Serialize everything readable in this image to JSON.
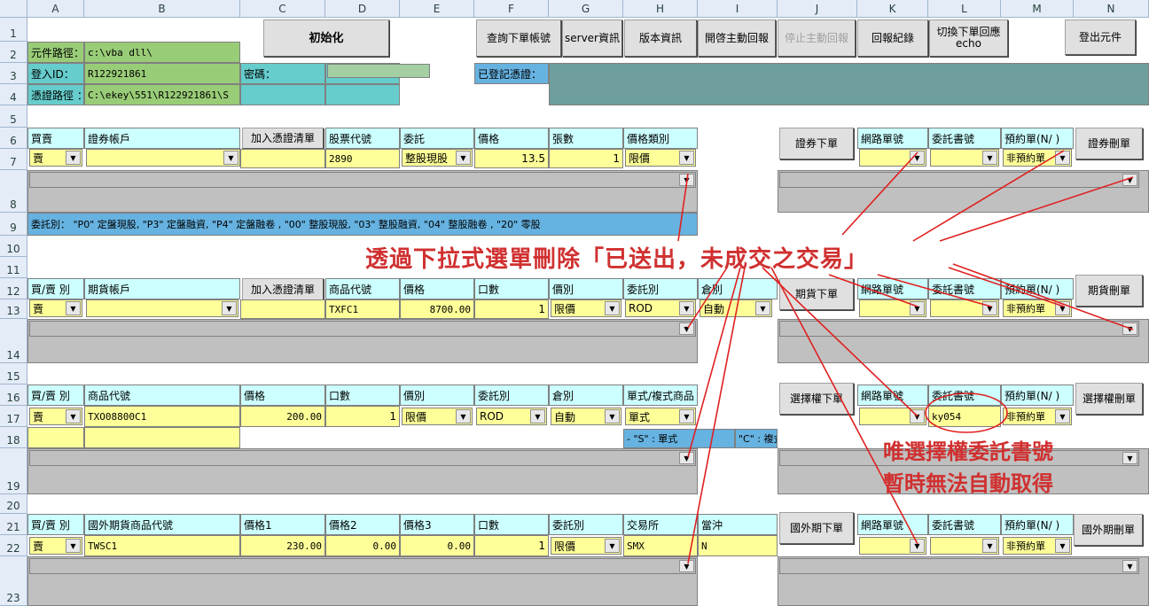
{
  "columns": [
    "A",
    "B",
    "C",
    "D",
    "E",
    "F",
    "G",
    "H",
    "I",
    "J",
    "K",
    "L",
    "M",
    "N"
  ],
  "rows": [
    "1",
    "2",
    "3",
    "4",
    "5",
    "6",
    "7",
    "8",
    "9",
    "10",
    "11",
    "12",
    "13",
    "14",
    "15",
    "16",
    "17",
    "18",
    "19",
    "20",
    "21",
    "22",
    "23"
  ],
  "top": {
    "init_button": "初始化",
    "query_account_button": "查詢下單帳號",
    "server_info_button": "server資訊",
    "version_button": "版本資訊",
    "open_reply_button": "開啓主動回報",
    "stop_reply_button": "停止主動回報",
    "reply_log_button": "回報紀錄",
    "switch_echo_button_line1": "切換下單回應",
    "switch_echo_button_line2": "echo",
    "logout_button": "登出元件",
    "dll_path_label": "元件路徑：",
    "dll_path_value": "c:\\vba dll\\",
    "login_id_label": "登入ID：",
    "login_id_value": "R122921861",
    "password_label": "密碼：",
    "cert_path_label": "憑證路徑 ：",
    "cert_path_value": "C:\\ekey\\551\\R122921861\\S",
    "registered_cert_label": "已登記憑證："
  },
  "stock": {
    "headers": [
      "買賣",
      "證券帳戶",
      "",
      "股票代號",
      "委託",
      "價格",
      "張數",
      "價格類別"
    ],
    "add_cert_button": "加入憑證清單",
    "side": "賣",
    "account": "",
    "symbol": "2890",
    "order_type": "整股現股",
    "price": "13.5",
    "qty": "1",
    "price_type": "限價",
    "submit_button": "證券下單",
    "net_no_label": "網路單號",
    "order_book_label": "委託書號",
    "preorder_label": "預約單(N/ )",
    "preorder_value": "非預約單",
    "delete_button": "證券刪單",
    "order_type_hint": "委託別：  \"P0\" 定盤現股, \"P3\" 定盤融資, \"P4\" 定盤融卷 , \"00\" 整股現股, \"03\" 整股融資, \"04\" 整股融卷 , \"20\" 零股"
  },
  "futures": {
    "headers": [
      "買/賣 別",
      "期貨帳戶",
      "",
      "商品代號",
      "價格",
      "口數",
      "價別",
      "委託別",
      "倉別"
    ],
    "add_cert_button": "加入憑證清單",
    "side": "賣",
    "symbol": "TXFC1",
    "price": "8700.00",
    "qty": "1",
    "price_type": "限價",
    "order_type": "ROD",
    "position": "自動",
    "submit_button": "期貨下單",
    "net_no_label": "網路單號",
    "order_book_label": "委託書號",
    "preorder_label": "預約單(N/ )",
    "preorder_value": "非預約單",
    "delete_button": "期貨刪單"
  },
  "options": {
    "headers": [
      "買/賣 別",
      "商品代號",
      "價格",
      "口數",
      "價別",
      "委託別",
      "倉別",
      "單式/複式商品"
    ],
    "side": "賣",
    "symbol": "TXO08800C1",
    "price": "200.00",
    "qty": "1",
    "price_type": "限價",
    "order_type": "ROD",
    "position": "自動",
    "combo_type": "單式",
    "combo_hint_s": "- \"S\" : 單式",
    "combo_hint_c": "\"C\" : 複式",
    "submit_button": "選擇權下單",
    "net_no_label": "網路單號",
    "order_book_label": "委託書號",
    "order_book_value": "ky054",
    "preorder_label": "預約單(N/ )",
    "preorder_value": "非預約單",
    "delete_button": "選擇權刪單"
  },
  "overseas": {
    "headers": [
      "買/賣 別",
      "國外期貨商品代號",
      "價格1",
      "價格2",
      "價格3",
      "口數",
      "委託別",
      "交易所",
      "當沖"
    ],
    "side": "賣",
    "symbol": "TWSC1",
    "price1": "230.00",
    "price2": "0.00",
    "price3": "0.00",
    "qty": "1",
    "order_type": "限價",
    "exchange": "SMX",
    "daytrade": "N",
    "submit_button": "國外期下單",
    "net_no_label": "網路單號",
    "order_book_label": "委託書號",
    "preorder_label": "預約單(N/ )",
    "preorder_value": "非預約單",
    "delete_button": "國外期刪單"
  },
  "annotations": {
    "main": "透過下拉式選單刪除「已送出，未成交之交易」",
    "note_line1": "唯選擇權委託書號",
    "note_line2": "暫時無法自動取得"
  },
  "colors": {
    "annotation": "#d03030",
    "input": "#ffff99",
    "header": "#ccffff"
  }
}
